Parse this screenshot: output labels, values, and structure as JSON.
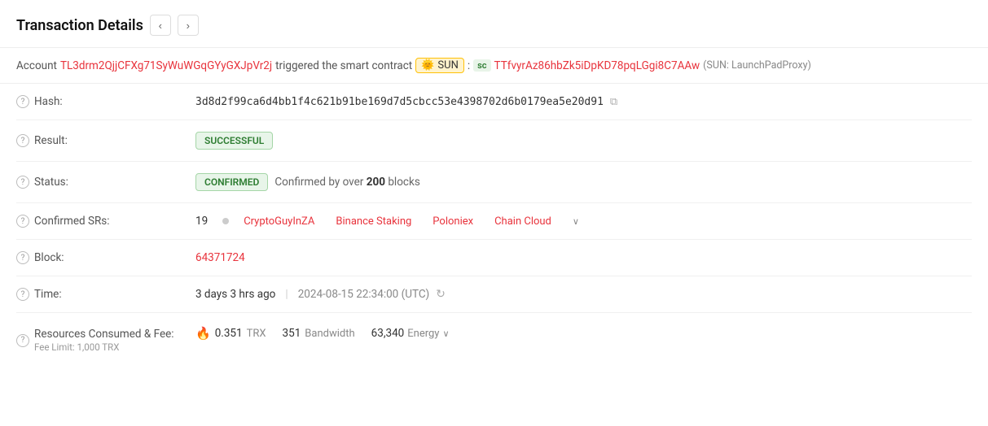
{
  "header": {
    "title": "Transaction Details",
    "nav_prev": "‹",
    "nav_next": "›"
  },
  "account_bar": {
    "prefix": "Account",
    "account_address": "TL3drm2QjjCFXg71SyWuWGqGYyGXJpVr2j",
    "trigger_text": "triggered the smart contract",
    "sun_label": "SUN",
    "sun_emoji": "🌞",
    "colon": ":",
    "sc_label": "sc",
    "contract_address": "TTfvyrAz86hbZk5iDpKD78pqLGgi8C7AAw",
    "proxy_label": "(SUN: LaunchPadProxy)"
  },
  "rows": {
    "hash": {
      "label": "Hash:",
      "value": "3d8d2f99ca6d4bb1f4c621b91be169d7d5cbcc53e4398702d6b0179ea5e20d91",
      "copy_icon": "⧉"
    },
    "result": {
      "label": "Result:",
      "badge": "SUCCESSFUL"
    },
    "status": {
      "label": "Status:",
      "badge": "CONFIRMED",
      "confirm_text": "Confirmed by over",
      "confirm_num": "200",
      "confirm_suffix": "blocks"
    },
    "confirmed_srs": {
      "label": "Confirmed SRs:",
      "count": "19",
      "sr_items": [
        "CryptoGuyInZA",
        "Binance Staking",
        "Poloniex",
        "Chain Cloud"
      ],
      "more_icon": "∨"
    },
    "block": {
      "label": "Block:",
      "value": "64371724"
    },
    "time": {
      "label": "Time:",
      "relative": "3 days 3 hrs ago",
      "separator": "|",
      "utc": "2024-08-15 22:34:00 (UTC)",
      "refresh_icon": "↻"
    },
    "resources": {
      "label": "Resources Consumed & Fee:",
      "fee_limit_label": "Fee Limit: 1,000 TRX",
      "fire_icon": "🔥",
      "trx_amount": "0.351",
      "trx_label": "TRX",
      "bandwidth_amount": "351",
      "bandwidth_label": "Bandwidth",
      "energy_amount": "63,340",
      "energy_label": "Energy",
      "dropdown_icon": "∨"
    }
  },
  "colors": {
    "red_link": "#e8333c",
    "green_badge_bg": "#e8f5e9",
    "green_badge_border": "#a5d6a7",
    "green_badge_text": "#2e7d32"
  }
}
